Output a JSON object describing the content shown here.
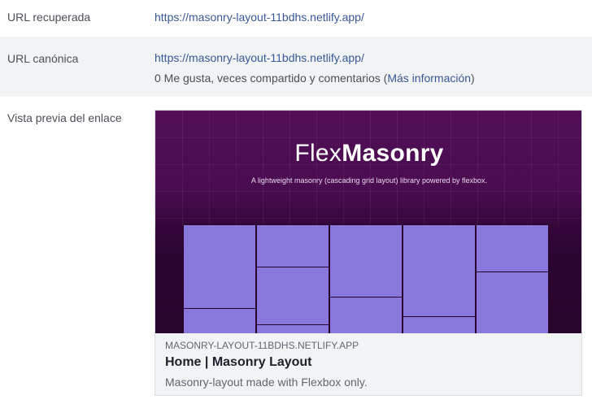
{
  "rows": {
    "fetched_url": {
      "label": "URL recuperada",
      "value": "https://masonry-layout-11bdhs.netlify.app/"
    },
    "canonical_url": {
      "label": "URL canónica",
      "value": "https://masonry-layout-11bdhs.netlify.app/",
      "stats_text": "0 Me gusta, veces compartido y comentarios (",
      "more_info_link": "Más información",
      "stats_close": ")"
    },
    "link_preview": {
      "label": "Vista previa del enlace"
    }
  },
  "preview_card": {
    "image": {
      "brand_light": "Flex",
      "brand_bold": "Masonry",
      "tagline": "A lightweight masonry (cascading grid layout) library powered by flexbox.",
      "tile_color": "#8878dc",
      "header_color": "#520f57"
    },
    "domain": "MASONRY-LAYOUT-11BDHS.NETLIFY.APP",
    "title": "Home | Masonry Layout",
    "description": "Masonry-layout made with Flexbox only."
  },
  "colors": {
    "link": "#385898",
    "row_alt_bg": "#f2f3f5",
    "label": "#4b4f56"
  }
}
